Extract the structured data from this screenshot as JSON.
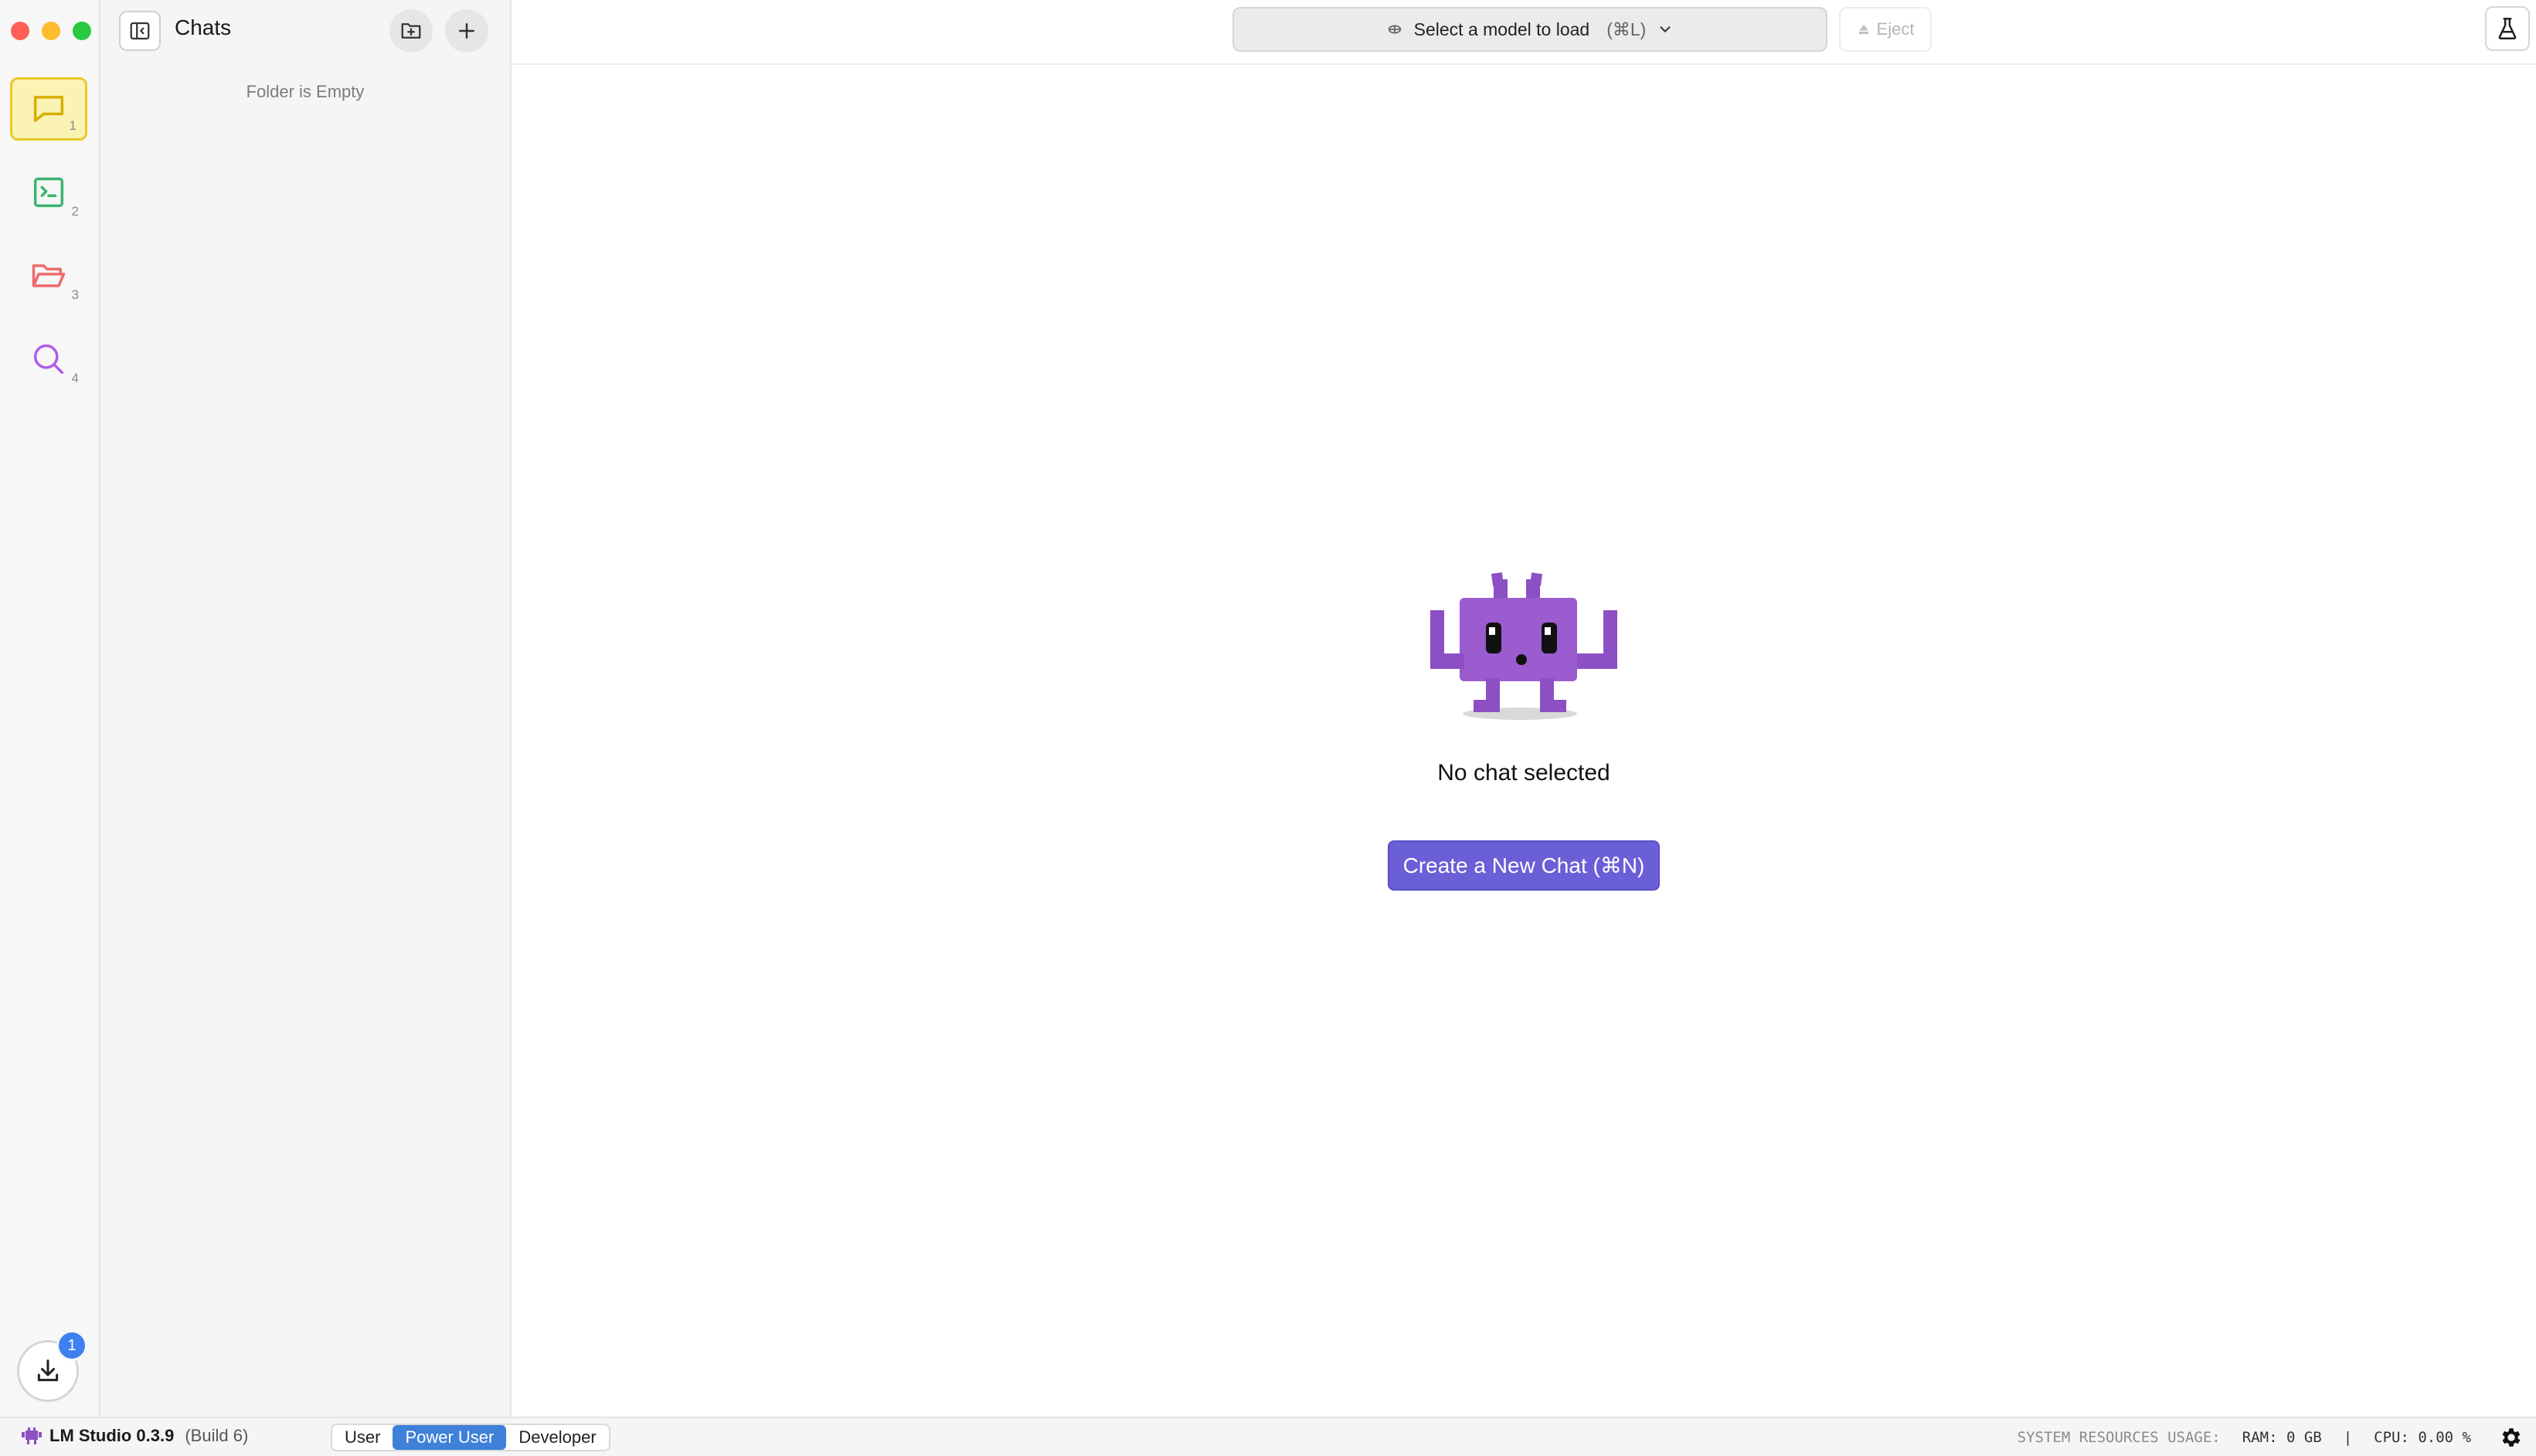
{
  "window": {
    "controls": [
      "close",
      "minimize",
      "maximize"
    ]
  },
  "rail": {
    "items": [
      {
        "name": "chat",
        "icon": "chat-bubble-icon",
        "number": "1",
        "active": true,
        "color": "#d9ad00"
      },
      {
        "name": "developer",
        "icon": "terminal-icon",
        "number": "2",
        "active": false,
        "color": "#3cb371"
      },
      {
        "name": "my-models",
        "icon": "folder-icon",
        "number": "3",
        "active": false,
        "color": "#ee6a6a"
      },
      {
        "name": "discover",
        "icon": "search-icon",
        "number": "4",
        "active": false,
        "color": "#b05ce6"
      }
    ],
    "downloads_badge": "1"
  },
  "chats_panel": {
    "title": "Chats",
    "empty_text": "Folder is Empty"
  },
  "topbar": {
    "model_select_label": "Select a model to load",
    "model_select_shortcut": "(⌘L)",
    "eject_label": "Eject"
  },
  "main": {
    "empty_title": "No chat selected",
    "create_button": "Create a New Chat (⌘N)"
  },
  "statusbar": {
    "app_name": "LM Studio 0.3.9",
    "build": "(Build 6)",
    "modes": [
      "User",
      "Power User",
      "Developer"
    ],
    "active_mode": "Power User",
    "resources_label": "SYSTEM RESOURCES USAGE:",
    "ram": "RAM: 0 GB",
    "separator": "|",
    "cpu": "CPU: 0.00 %"
  },
  "colors": {
    "accent": "#6a5fd6",
    "mode_active": "#3f80d8",
    "badge": "#3f80f0"
  }
}
